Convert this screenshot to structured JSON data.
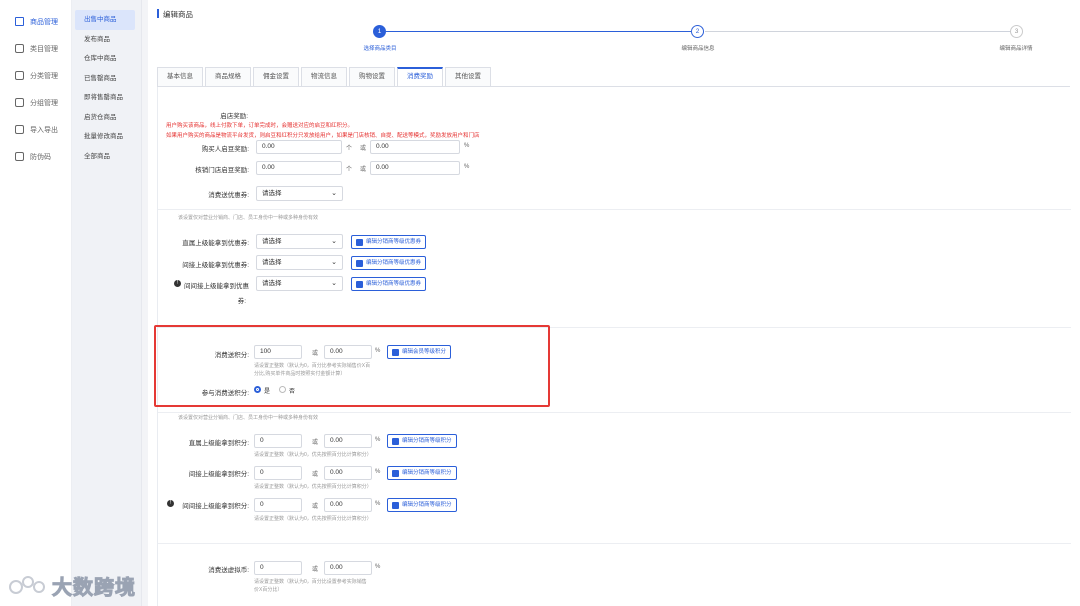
{
  "sidebar": {
    "items": [
      {
        "label": "商品管理",
        "icon": "shop-bag-icon",
        "active": true
      },
      {
        "label": "类目管理",
        "icon": "category-icon",
        "active": false
      },
      {
        "label": "分类管理",
        "icon": "classify-icon",
        "active": false
      },
      {
        "label": "分组管理",
        "icon": "group-icon",
        "active": false
      },
      {
        "label": "导入导出",
        "icon": "import-export-icon",
        "active": false
      },
      {
        "label": "防伪码",
        "icon": "anti-fake-icon",
        "active": false
      }
    ]
  },
  "subnav": {
    "items": [
      "出售中商品",
      "发布商品",
      "仓库中商品",
      "已售罄商品",
      "即将售罄商品",
      "启货仓商品",
      "批量修改商品",
      "全部商品"
    ]
  },
  "header": {
    "title": "编辑商品"
  },
  "steps": [
    {
      "num": "1",
      "label": "选择商品类目",
      "active": true
    },
    {
      "num": "2",
      "label": "编辑商品信息",
      "active": false
    },
    {
      "num": "3",
      "label": "编辑商品详情",
      "active": false
    }
  ],
  "tabs": [
    "基本信息",
    "商品规格",
    "佣金设置",
    "物流信息",
    "购物设置",
    "消费奖励",
    "其他设置"
  ],
  "active_tab": "消费奖励",
  "form": {
    "shop_reward_label": "启店奖励:",
    "shop_reward_note1": "用户购买该商品，线上付款下单，订单完成时，会赠送对应的启豆和红积分。",
    "shop_reward_note2": "如果用户购买的商品是物流平台发货，则启豆和红积分只发放给用户，如果是门店核销、自提、配送等模式，奖励发放用户和门店",
    "buyer_label": "购买人启豆奖励:",
    "buyer_value1": "0.00",
    "buyer_unit1": "个",
    "buyer_or": "或",
    "buyer_value2": "0.00",
    "buyer_unit2": "%",
    "store_label": "核销门店启豆奖励:",
    "store_value1": "0.00",
    "store_unit1": "个",
    "store_or": "或",
    "store_value2": "0.00",
    "store_unit2": "%",
    "coupon_label": "消费送优惠券:",
    "coupon_select": "请选择",
    "coupon_hint": "该设置仅对营业分销商、门店、员工身份中一种或多种身份有效",
    "direct_coupon_label": "直属上级能拿到优惠券:",
    "direct_coupon_select": "请选择",
    "direct_coupon_btn": "编辑分销商等级优惠券",
    "indirect_coupon_label": "间接上级能拿到优惠券:",
    "indirect_coupon_select": "请选择",
    "indirect_coupon_btn": "编辑分销商等级优惠券",
    "indirect2_coupon_label1": "间间接上级能拿到优惠",
    "indirect2_coupon_label2": "券:",
    "indirect2_coupon_select": "请选择",
    "indirect2_coupon_btn": "编辑分销商等级优惠券",
    "points_label": "消费送积分:",
    "points_value1": "100",
    "points_or": "或",
    "points_value2": "0.00",
    "points_unit": "%",
    "points_btn": "编辑会员等级积分",
    "points_hint1": "请设置正整数（默认为0，百分比参考实际销售价X百",
    "points_hint2": "分比,购买单件商品时按照实付金额计算）",
    "join_points_label": "参与消费送积分:",
    "join_yes": "是",
    "join_no": "否",
    "points_scope_hint": "该设置仅对营业分销商、门店、员工身份中一种或多种身份有效",
    "direct_points_label": "直属上级能拿到积分:",
    "direct_points_value1": "0",
    "direct_points_or": "或",
    "direct_points_value2": "0.00",
    "direct_points_unit": "%",
    "direct_points_btn": "编辑分销商等级积分",
    "direct_points_hint": "请设置正整数（默认为0，优先按照百分比计算积分）",
    "indirect_points_label": "间接上级能拿到积分:",
    "indirect_points_value1": "0",
    "indirect_points_or": "或",
    "indirect_points_value2": "0.00",
    "indirect_points_unit": "%",
    "indirect_points_btn": "编辑分销商等级积分",
    "indirect_points_hint": "请设置正整数（默认为0，优先按照百分比计算积分）",
    "indirect2_points_label": "间间接上级能拿到积分:",
    "indirect2_points_value1": "0",
    "indirect2_points_or": "或",
    "indirect2_points_value2": "0.00",
    "indirect2_points_unit": "%",
    "indirect2_points_btn": "编辑分销商等级积分",
    "indirect2_points_hint": "请设置正整数（默认为0，优先按照百分比计算积分）",
    "currency_label": "消费送虚拟币:",
    "currency_value1": "0",
    "currency_or": "或",
    "currency_value2": "0.00",
    "currency_unit": "%",
    "currency_hint1": "请设置正整数（默认为0，百分比设置参考实际销售",
    "currency_hint2": "价X百分比）"
  },
  "watermark": {
    "text": "大数跨境"
  },
  "colors": {
    "accent": "#2b5fd9",
    "highlight": "#e53935",
    "note_red": "#e5302f"
  }
}
